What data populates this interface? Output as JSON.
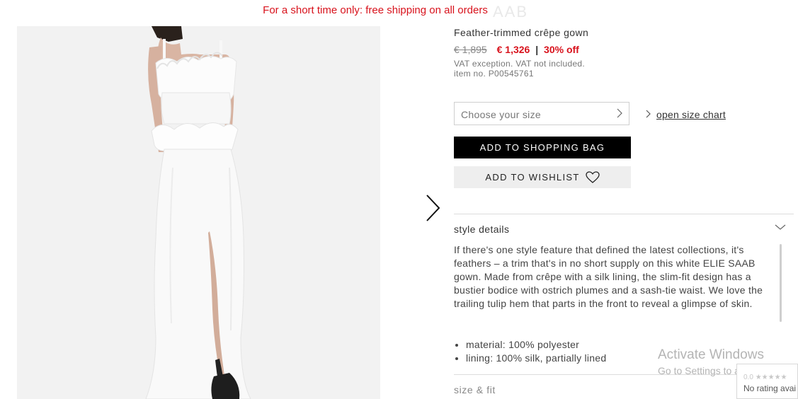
{
  "promo_banner": "For a short time only: free shipping on all orders",
  "brand": "AAB",
  "product": {
    "title": "Feather-trimmed crêpe gown",
    "price_old": "€ 1,895",
    "price_new": "€ 1,326",
    "price_separator": "|",
    "discount": "30% off",
    "vat_note": "VAT exception. VAT not included.",
    "item_no": "item no. P00545761"
  },
  "size_select": {
    "placeholder": "Choose your size"
  },
  "size_chart_link": "open size chart",
  "buttons": {
    "add_to_bag": "ADD TO SHOPPING BAG",
    "add_to_wishlist": "ADD TO WISHLIST"
  },
  "style_details": {
    "header": "style details",
    "description": "If there's one style feature that defined the latest collections, it's feathers – a trim that's in no short supply on this white ELIE SAAB gown. Made from crêpe with a silk lining, the slim-fit design has a bustier bodice with ostrich plumes and a sash-tie waist. We love the trailing tulip hem that parts in the front to reveal a glimpse of skin.",
    "bullets": [
      "material: 100% polyester",
      "lining: 100% silk, partially lined"
    ]
  },
  "size_fit_header": "size & fit",
  "os_watermark": {
    "line1": "Activate Windows",
    "line2": "Go to Settings to activate Win"
  },
  "rating_widget": {
    "score": "0.0",
    "stars": "★★★★★",
    "label": "No rating avai"
  },
  "icons": {
    "next": "chevron-right-icon",
    "size_chevron": "chevron-right-icon",
    "wishlist": "heart-icon",
    "accordion": "chevron-down-icon"
  },
  "colors": {
    "accent_red": "#d8121c",
    "button_black": "#000000",
    "wishlist_bg": "#eeeeee",
    "image_bg": "#f2f2f2"
  }
}
